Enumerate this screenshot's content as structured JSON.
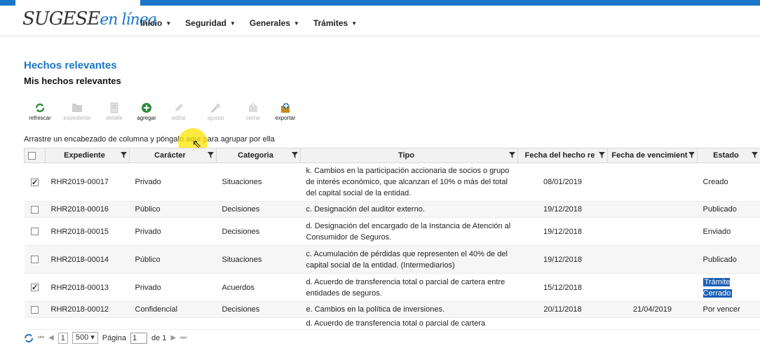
{
  "brand": {
    "logo_main": "SUGESE",
    "logo_accent": "en línea"
  },
  "nav": [
    {
      "label": "Inicio"
    },
    {
      "label": "Seguridad"
    },
    {
      "label": "Generales"
    },
    {
      "label": "Trámites"
    }
  ],
  "page": {
    "title": "Hechos relevantes",
    "subtitle": "Mis hechos relevantes"
  },
  "toolbar": {
    "refrescar": "refrescar",
    "expediente": "expediente",
    "detalle": "detalle",
    "agregar": "agregar",
    "editar": "editar",
    "ajustar": "ajustar",
    "cerrar": "cerrar",
    "exportar": "exportar"
  },
  "group_hint": "Arrastre un encabezado de columna y póngalo aquí para agrupar por ella",
  "columns": {
    "expediente": "Expediente",
    "caracter": "Carácter",
    "categoria": "Categoria",
    "tipo": "Tipo",
    "fecha_hecho": "Fecha del hecho re",
    "fecha_venc": "Fecha de vencimient",
    "estado": "Estado"
  },
  "rows": [
    {
      "checked": true,
      "expediente": "RHR2019-00017",
      "caracter": "Privado",
      "categoria": "Situaciones",
      "tipo": "k. Cambios en la participación accionaria de socios o grupo de interés económico, que alcanzan el 10% o más del total del capital social de la entidad.",
      "fecha_hecho": "08/01/2019",
      "fecha_venc": "",
      "estado": "Creado"
    },
    {
      "checked": false,
      "expediente": "RHR2018-00016",
      "caracter": "Público",
      "categoria": "Decisiones",
      "tipo": "c. Designación del auditor externo.",
      "fecha_hecho": "19/12/2018",
      "fecha_venc": "",
      "estado": "Publicado"
    },
    {
      "checked": false,
      "expediente": "RHR2018-00015",
      "caracter": "Privado",
      "categoria": "Decisiones",
      "tipo": "d. Designación del encargado de la Instancia de Atención al Consumidor de Seguros.",
      "fecha_hecho": "19/12/2018",
      "fecha_venc": "",
      "estado": "Enviado"
    },
    {
      "checked": false,
      "expediente": "RHR2018-00014",
      "caracter": "Público",
      "categoria": "Situaciones",
      "tipo": "c. Acumulación de pérdidas que representen el 40% de del capital social de la entidad. (Intermediarios)",
      "fecha_hecho": "19/12/2018",
      "fecha_venc": "",
      "estado": "Publicado"
    },
    {
      "checked": true,
      "expediente": "RHR2018-00013",
      "caracter": "Privado",
      "categoria": "Acuerdos",
      "tipo": "d. Acuerdo de transferencia total o parcial de cartera entre entidades de seguros.",
      "fecha_hecho": "15/12/2018",
      "fecha_venc": "",
      "estado": "Trámite Cerrado"
    },
    {
      "checked": false,
      "expediente": "RHR2018-00012",
      "caracter": "Confidencial",
      "categoria": "Decisiones",
      "tipo": "e. Cambios en la política de inversiones.",
      "fecha_hecho": "20/11/2018",
      "fecha_venc": "21/04/2019",
      "estado": "Por vencer"
    },
    {
      "checked": false,
      "expediente": "",
      "caracter": "",
      "categoria": "",
      "tipo": "d. Acuerdo de transferencia total o parcial de cartera",
      "fecha_hecho": "",
      "fecha_venc": "",
      "estado": ""
    }
  ],
  "pager": {
    "current_page": "1",
    "page_size": "500",
    "page_label": "Página",
    "page_input": "1",
    "of_label": "de 1"
  },
  "colors": {
    "accent": "#1a76c9",
    "selection": "#1a5fb4",
    "highlight": "#ffe400"
  }
}
